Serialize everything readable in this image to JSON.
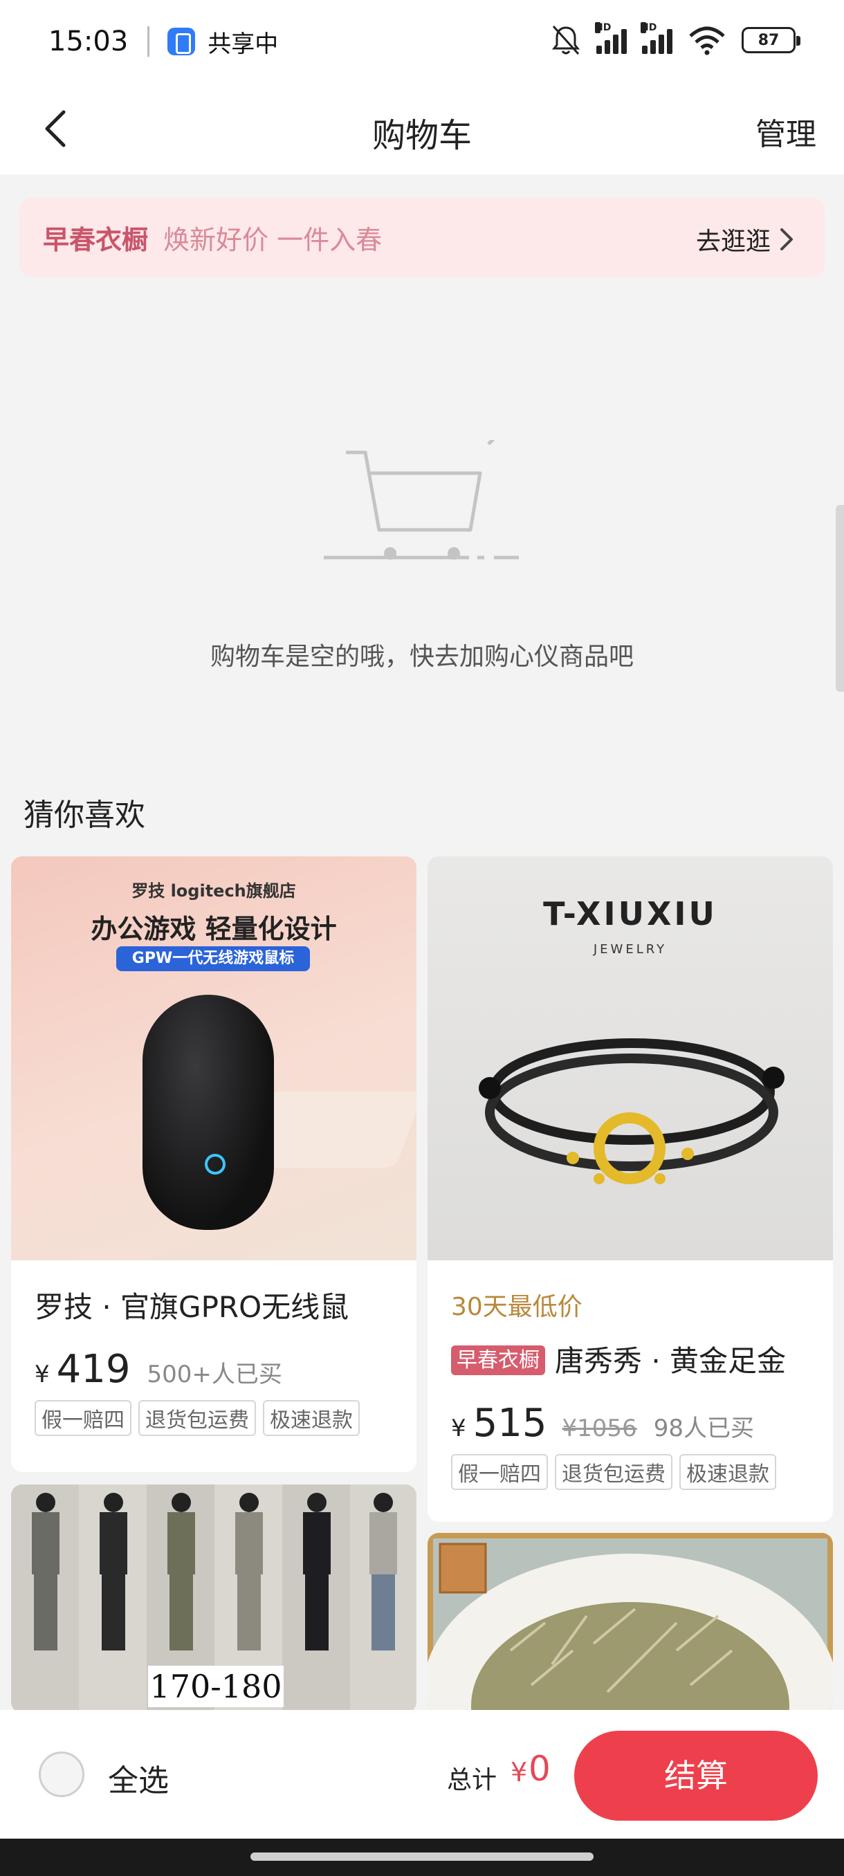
{
  "status_bar": {
    "time": "15:03",
    "share_text": "共享中",
    "battery": "87",
    "signal_hd": "HD"
  },
  "nav": {
    "title": "购物车",
    "manage_label": "管理"
  },
  "promo": {
    "tag": "早春衣橱",
    "text": "焕新好价 一件入春",
    "link_label": "去逛逛"
  },
  "empty": {
    "message": "购物车是空的哦，快去加购心仪商品吧"
  },
  "recommendations": {
    "title": "猜你喜欢",
    "items": [
      {
        "image_store": "罗技 logitech旗舰店",
        "image_headline": "办公游戏 轻量化设计",
        "image_pill": "GPW一代无线游戏鼠标",
        "title": "罗技 · 官旗GPRO无线鼠",
        "currency": "¥",
        "price": "419",
        "sold": "500+人已买",
        "tags": [
          "假一赔四",
          "退货包运费",
          "极速退款"
        ]
      },
      {
        "image_brand": "T-XIUXIU",
        "image_sub": "JEWELRY",
        "lowest_label": "30天最低价",
        "inline_tag": "早春衣橱",
        "title": "唐秀秀 · 黄金足金",
        "currency": "¥",
        "price": "515",
        "old_price": "¥1056",
        "sold": "98人已买",
        "tags": [
          "假一赔四",
          "退货包运费",
          "极速退款"
        ]
      },
      {
        "image_label": "170-180"
      },
      {
        "image_label": ""
      }
    ]
  },
  "bottom_bar": {
    "select_all_label": "全选",
    "total_label": "总计",
    "currency": "¥",
    "total_value": "0",
    "checkout_label": "结算"
  },
  "colors": {
    "accent": "#ee3f4d",
    "promo_bg": "#fde8ea",
    "promo_tag": "#c9556a",
    "lowest_price": "#b9883a"
  }
}
